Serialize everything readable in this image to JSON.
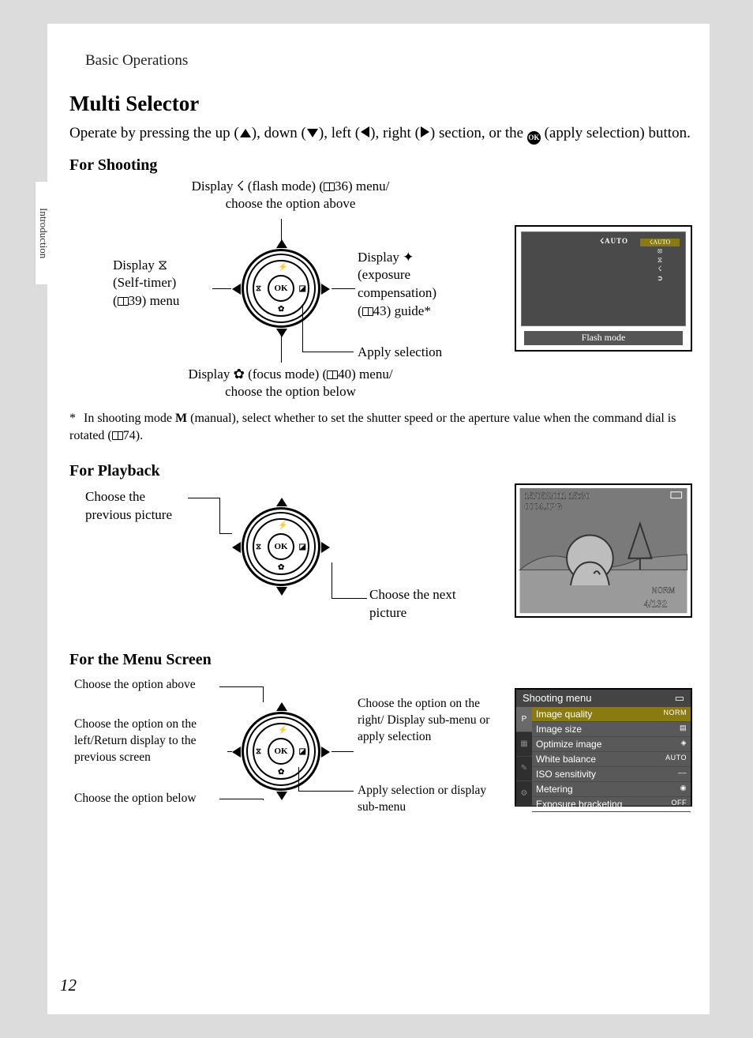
{
  "header": {
    "breadcrumb": "Basic Operations",
    "side_tab": "Introduction",
    "page_number": "12"
  },
  "title": "Multi Selector",
  "intro": {
    "before_up": "Operate by pressing the up (",
    "between_up_down": "), down (",
    "between_down_left": "), left (",
    "between_left_right": "), right (",
    "between_right_ok": ") section, or the ",
    "after_ok": " (apply selection) button."
  },
  "shooting": {
    "heading": "For Shooting",
    "up_l1": "Display ☇ (flash mode) (",
    "up_ref": "36",
    "up_l2": ") menu/",
    "up_l3": "choose the option above",
    "left_l1": "Display ⧖",
    "left_l2": "(Self-timer)",
    "left_l3_a": "(",
    "left_ref": "39",
    "left_l3_b": ") menu",
    "right_l1": "Display ✦",
    "right_l2": "(exposure",
    "right_l3": "compensation)",
    "right_l4_a": "(",
    "right_ref": "43",
    "right_l4_b": ") guide*",
    "apply": "Apply selection",
    "down_l1": "Display ✿ (focus mode) (",
    "down_ref": "40",
    "down_l2": ") menu/",
    "down_l3": "choose the option below",
    "lcd": {
      "auto": "☇AUTO",
      "bar_label": "Flash mode",
      "icons": [
        "☇AUTO",
        "⦻",
        "⧖",
        "☇",
        "➲",
        "⬛"
      ]
    },
    "footnote_a": "In shooting mode ",
    "footnote_m": "M",
    "footnote_b": " (manual), select whether to set the shutter speed or the aperture value when the command dial is rotated (",
    "footnote_ref": "74",
    "footnote_c": ")."
  },
  "playback": {
    "heading": "For Playback",
    "left": "Choose the previous picture",
    "right": "Choose the next picture",
    "lcd": {
      "date": "15/05/2011 15:30",
      "file": "0004.JPG",
      "norm": "NORM",
      "counter": "4/132"
    }
  },
  "menu": {
    "heading": "For the Menu Screen",
    "up": "Choose the option above",
    "left": "Choose the option on the left/Return display to the previous screen",
    "down": "Choose the option below",
    "right": "Choose the option on the right/ Display sub-menu or apply selection",
    "ok": "Apply selection or display sub-menu",
    "lcd": {
      "title": "Shooting menu",
      "mode": "P",
      "rows": [
        {
          "label": "Image quality",
          "value": "NORM",
          "sel": true
        },
        {
          "label": "Image size",
          "value": "▤"
        },
        {
          "label": "Optimize image",
          "value": "◈"
        },
        {
          "label": "White balance",
          "value": "AUTO"
        },
        {
          "label": "ISO sensitivity",
          "value": "––"
        },
        {
          "label": "Metering",
          "value": "◉"
        },
        {
          "label": "Exposure bracketing",
          "value": "OFF"
        }
      ]
    }
  }
}
